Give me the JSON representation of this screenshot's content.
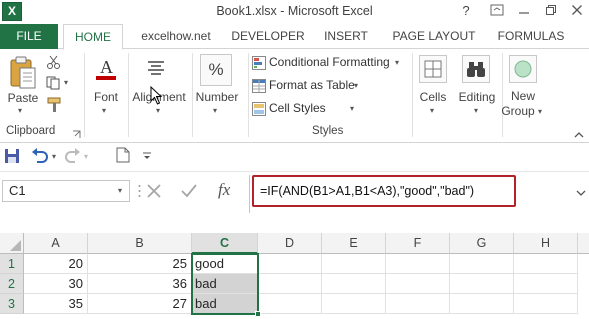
{
  "window": {
    "title": "Book1.xlsx - Microsoft Excel",
    "app_icon": "X",
    "help": "?",
    "buttons": [
      "minimize",
      "restore",
      "close"
    ]
  },
  "tabs": {
    "file": "FILE",
    "items": [
      "HOME",
      "excelhow.net",
      "DEVELOPER",
      "INSERT",
      "PAGE LAYOUT",
      "FORMULAS"
    ],
    "active": "HOME"
  },
  "ribbon": {
    "clipboard": {
      "paste": "Paste",
      "group_label": "Clipboard"
    },
    "font": {
      "label": "Font"
    },
    "alignment": {
      "label": "Alignment"
    },
    "number": {
      "label": "Number",
      "icon_text": "%"
    },
    "styles": {
      "conditional_formatting": "Conditional Formatting",
      "format_as_table": "Format as Table",
      "cell_styles": "Cell Styles",
      "group_label": "Styles"
    },
    "cells": {
      "label": "Cells"
    },
    "editing": {
      "label": "Editing"
    },
    "new_group": {
      "label_line1": "New",
      "label_line2": "Group"
    },
    "font_icon_text": "A"
  },
  "formula_bar": {
    "name_box": "C1",
    "fx": "fx",
    "formula": "=IF(AND(B1>A1,B1<A3),\"good\",\"bad\")"
  },
  "sheet": {
    "columns": [
      "A",
      "B",
      "C",
      "D",
      "E",
      "F",
      "G",
      "H"
    ],
    "active_column": "C",
    "rows": [
      {
        "num": "1",
        "A": "20",
        "B": "25",
        "C": "good"
      },
      {
        "num": "2",
        "A": "30",
        "B": "36",
        "C": "bad"
      },
      {
        "num": "3",
        "A": "35",
        "B": "27",
        "C": "bad"
      }
    ]
  }
}
